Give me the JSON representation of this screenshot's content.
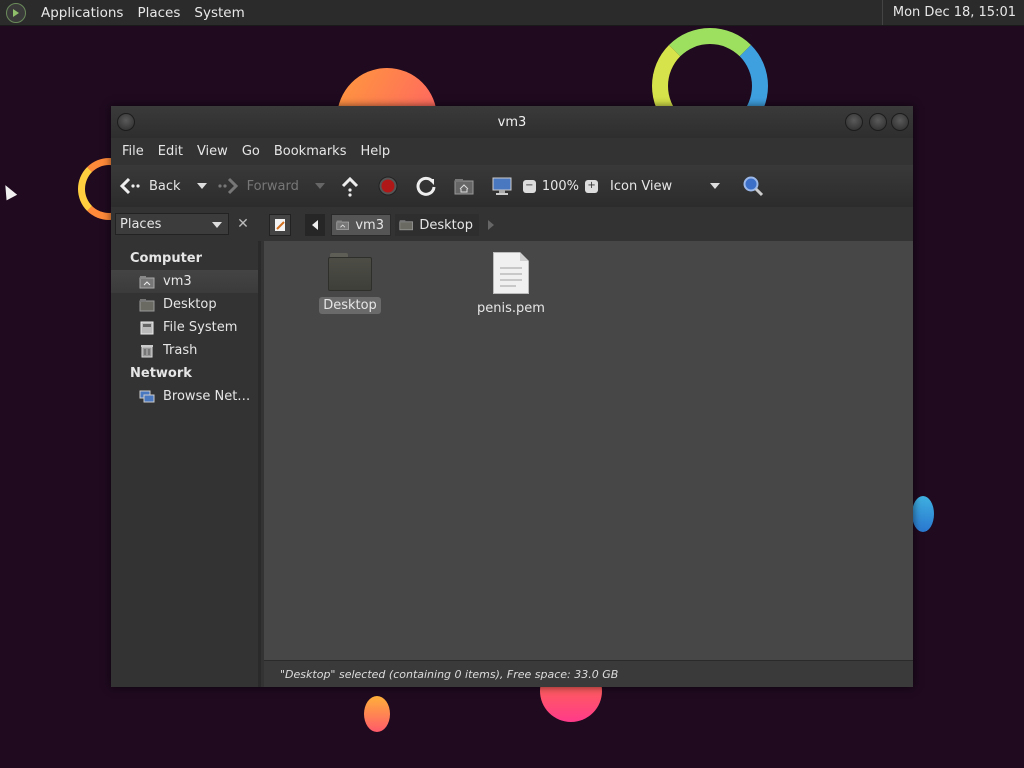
{
  "panel": {
    "applications": "Applications",
    "places": "Places",
    "system": "System",
    "clock": "Mon Dec 18, 15:01"
  },
  "window": {
    "title": "vm3",
    "menu": [
      "File",
      "Edit",
      "View",
      "Go",
      "Bookmarks",
      "Help"
    ],
    "toolbar": {
      "back": "Back",
      "forward": "Forward",
      "zoom": "100%",
      "view_mode": "Icon View"
    },
    "location": {
      "sidebar_selector": "Places",
      "crumbs": [
        "vm3",
        "Desktop"
      ]
    },
    "sidebar": {
      "computer_header": "Computer",
      "computer_items": [
        "vm3",
        "Desktop",
        "File System",
        "Trash"
      ],
      "network_header": "Network",
      "network_items": [
        "Browse Net…"
      ]
    },
    "files": [
      {
        "name": "Desktop",
        "type": "folder",
        "selected": true
      },
      {
        "name": "penis.pem",
        "type": "document",
        "selected": false
      }
    ],
    "status": "\"Desktop\" selected (containing 0 items), Free space: 33.0 GB"
  }
}
